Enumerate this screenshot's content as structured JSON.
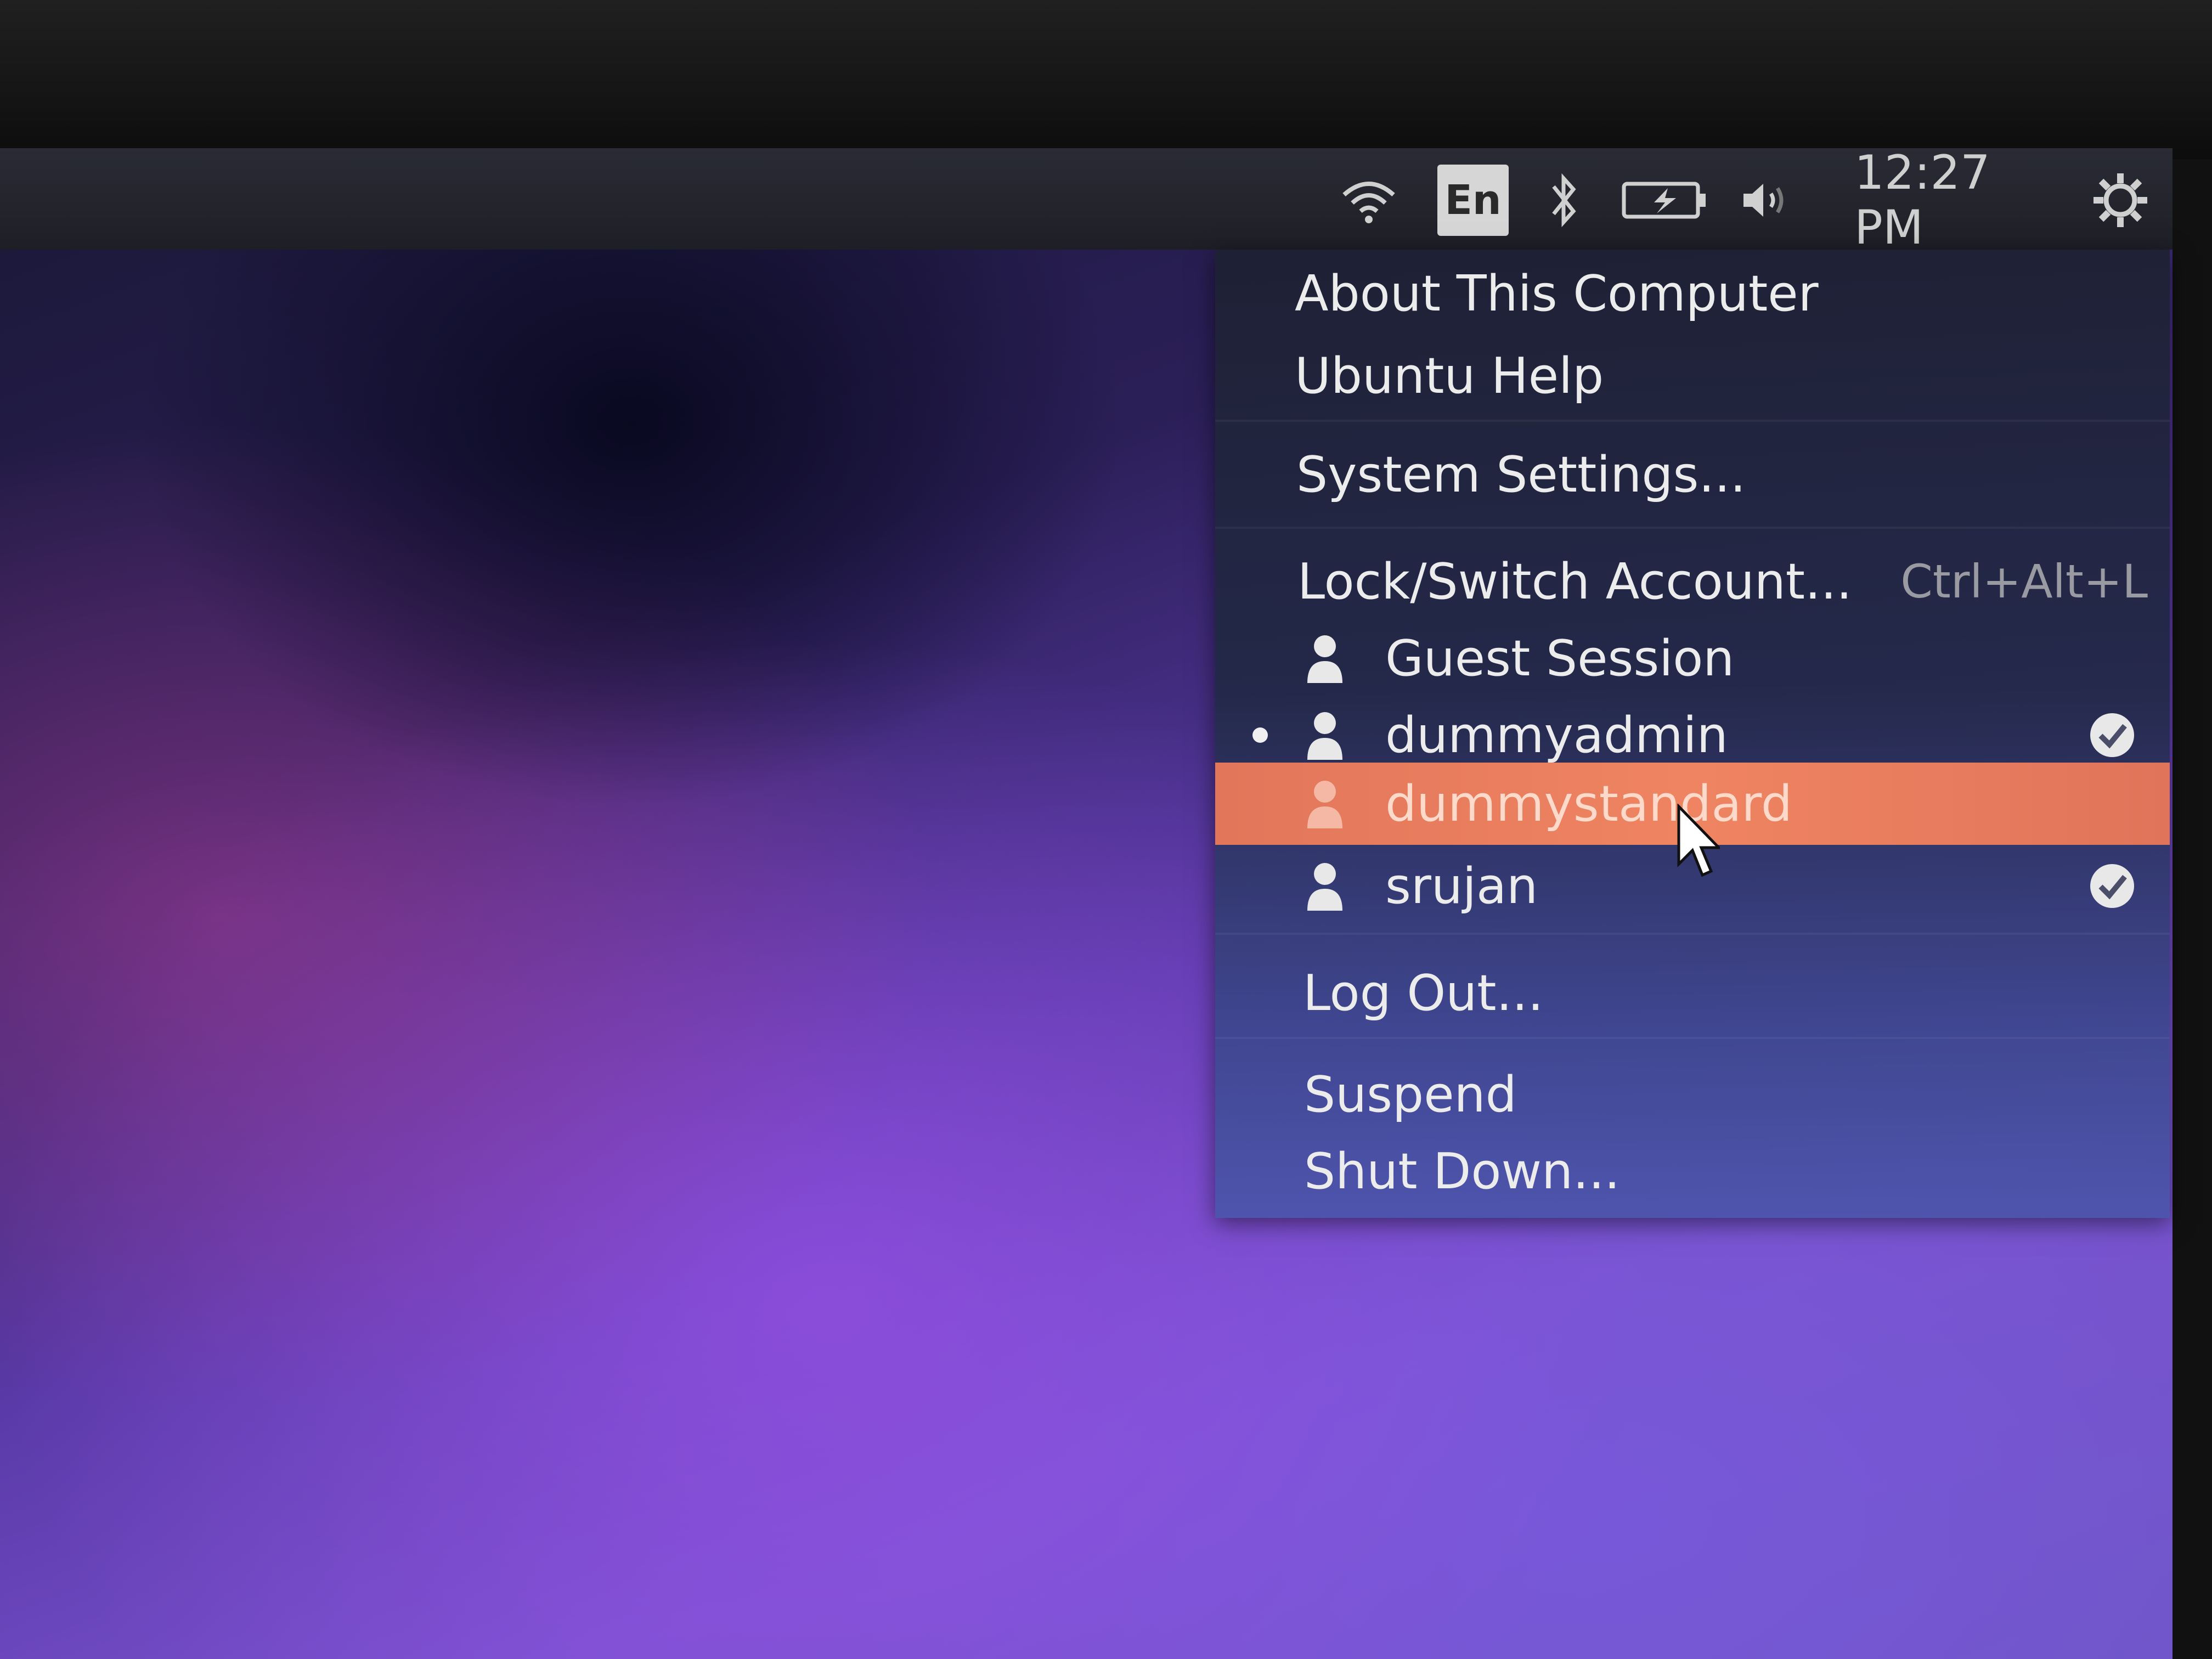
{
  "panel": {
    "indicators": [
      {
        "name": "wifi-icon"
      },
      {
        "name": "keyboard-language",
        "label": "En"
      },
      {
        "name": "bluetooth-icon"
      },
      {
        "name": "battery-icon"
      },
      {
        "name": "volume-icon"
      }
    ],
    "clock": "12:27 PM",
    "session_icon": "gear-icon"
  },
  "menu": {
    "about": "About This Computer",
    "help": "Ubuntu Help",
    "settings": "System Settings...",
    "lock": {
      "label": "Lock/Switch Account...",
      "accel": "Ctrl+Alt+L"
    },
    "users": [
      {
        "name": "Guest Session",
        "current": false,
        "logged_in": false,
        "highlighted": false
      },
      {
        "name": "dummyadmin",
        "current": true,
        "logged_in": true,
        "highlighted": false
      },
      {
        "name": "dummystandard",
        "current": false,
        "logged_in": false,
        "highlighted": true
      },
      {
        "name": "srujan",
        "current": false,
        "logged_in": true,
        "highlighted": false
      }
    ],
    "logout": "Log Out...",
    "suspend": "Suspend",
    "shutdown": "Shut Down..."
  },
  "colors": {
    "highlight": "#ef8462",
    "panel": "#1e1f26",
    "menu": "#22284a"
  }
}
